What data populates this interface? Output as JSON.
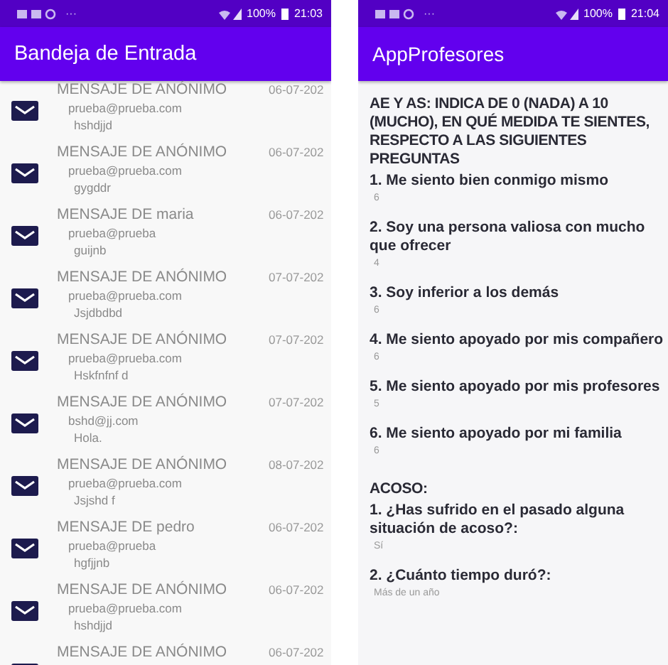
{
  "inbox_screen": {
    "status_bar": {
      "more": "···",
      "battery": "100%",
      "time": "21:03"
    },
    "app_bar": {
      "title": "Bandeja de Entrada"
    },
    "messages": [
      {
        "title": "MENSAJE DE ANÓNIMO",
        "email": "prueba@prueba.com",
        "body": "hshdjjd",
        "date": "06-07-202"
      },
      {
        "title": "MENSAJE DE ANÓNIMO",
        "email": "prueba@prueba.com",
        "body": "gygddr",
        "date": "06-07-202"
      },
      {
        "title": "MENSAJE DE maria",
        "email": "prueba@prueba",
        "body": "guijnb",
        "date": "06-07-202"
      },
      {
        "title": "MENSAJE DE ANÓNIMO",
        "email": "prueba@prueba.com",
        "body": "Jsjdbdbd",
        "date": "07-07-202"
      },
      {
        "title": "MENSAJE DE ANÓNIMO",
        "email": "prueba@prueba.com",
        "body": "Hskfnfnf d",
        "date": "07-07-202"
      },
      {
        "title": "MENSAJE DE ANÓNIMO",
        "email": "bshd@jj.com",
        "body": "Hola.",
        "date": "07-07-202"
      },
      {
        "title": "MENSAJE DE ANÓNIMO",
        "email": "prueba@prueba.com",
        "body": "Jsjshd f",
        "date": "08-07-202"
      },
      {
        "title": "MENSAJE DE pedro",
        "email": "prueba@prueba",
        "body": "hgfjjnb",
        "date": "06-07-202"
      },
      {
        "title": "MENSAJE DE ANÓNIMO",
        "email": "prueba@prueba.com",
        "body": "hshdjjd",
        "date": "06-07-202"
      },
      {
        "title": "MENSAJE DE ANÓNIMO",
        "date": "06-07-202"
      }
    ]
  },
  "survey_screen": {
    "status_bar": {
      "more": "···",
      "battery": "100%",
      "time": "21:04"
    },
    "app_bar": {
      "title": "AppProfesores"
    },
    "sections": [
      {
        "heading": "AE Y AS: INDICA DE 0 (NADA) A 10 (MUCHO), EN QUÉ MEDIDA TE SIENTES, RESPECTO A LAS SIGUIENTES PREGUNTAS",
        "questions": [
          {
            "question": "1. Me siento bien conmigo mismo",
            "answer": "6"
          },
          {
            "question": "2. Soy una persona valiosa con mucho que ofrecer",
            "answer": "4"
          },
          {
            "question": "3. Soy inferior a los demás",
            "answer": "6"
          },
          {
            "question": "4. Me siento apoyado por mis compañero",
            "answer": "6"
          },
          {
            "question": "5. Me siento apoyado por mis profesores",
            "answer": "5"
          },
          {
            "question": "6. Me siento apoyado por mi familia",
            "answer": "6"
          }
        ]
      },
      {
        "heading": "ACOSO:",
        "questions": [
          {
            "question": "1. ¿Has sufrido en el pasado alguna situación de acoso?:",
            "answer": "Sí"
          },
          {
            "question": "2. ¿Cuánto tiempo duró?:",
            "answer": "Más de un año"
          }
        ]
      }
    ]
  }
}
